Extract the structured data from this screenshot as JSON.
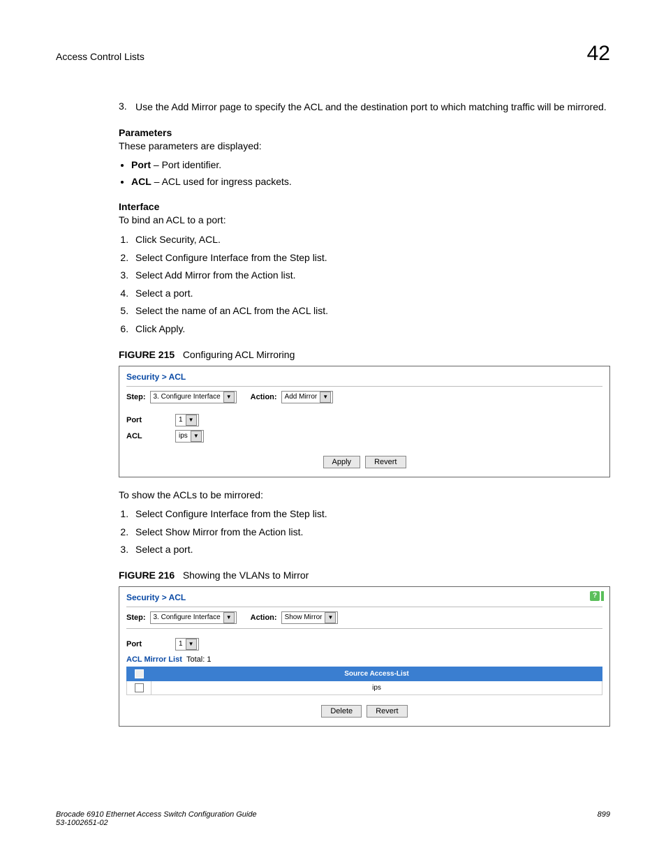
{
  "header": {
    "section": "Access Control Lists",
    "chapter": "42"
  },
  "intro_step": {
    "num": "3.",
    "text": "Use the Add Mirror page to specify the ACL and the destination port to which matching traffic will be mirrored."
  },
  "parameters": {
    "heading": "Parameters",
    "intro": "These parameters are displayed:",
    "items": [
      {
        "term": "Port",
        "desc": " – Port identifier."
      },
      {
        "term": "ACL",
        "desc": " – ACL used for ingress packets."
      }
    ]
  },
  "interface": {
    "heading": "Interface",
    "intro": "To bind an ACL to a port:",
    "steps": [
      "Click Security, ACL.",
      "Select Configure Interface from the Step list.",
      "Select Add Mirror from the Action list.",
      "Select a port.",
      "Select the name of an ACL from the ACL list.",
      "Click Apply."
    ]
  },
  "figure215": {
    "label": "FIGURE 215",
    "caption": "Configuring ACL Mirroring",
    "breadcrumb": "Security > ACL",
    "step_label": "Step:",
    "step_value": "3. Configure Interface",
    "action_label": "Action:",
    "action_value": "Add Mirror",
    "port_label": "Port",
    "port_value": "1",
    "acl_label": "ACL",
    "acl_value": "ips",
    "apply": "Apply",
    "revert": "Revert"
  },
  "show_section": {
    "intro": "To show the ACLs to be mirrored:",
    "steps": [
      "Select Configure Interface from the Step list.",
      "Select Show Mirror from the Action list.",
      "Select a port."
    ]
  },
  "figure216": {
    "label": "FIGURE 216",
    "caption": "Showing the VLANs to Mirror",
    "breadcrumb": "Security > ACL",
    "step_label": "Step:",
    "step_value": "3. Configure Interface",
    "action_label": "Action:",
    "action_value": "Show Mirror",
    "port_label": "Port",
    "port_value": "1",
    "list_title": "ACL Mirror List",
    "list_total": "Total: 1",
    "col_header": "Source Access-List",
    "row_value": "ips",
    "delete": "Delete",
    "revert": "Revert",
    "help": "?"
  },
  "footer": {
    "left1": "Brocade 6910 Ethernet Access Switch Configuration Guide",
    "left2": "53-1002651-02",
    "right": "899"
  }
}
